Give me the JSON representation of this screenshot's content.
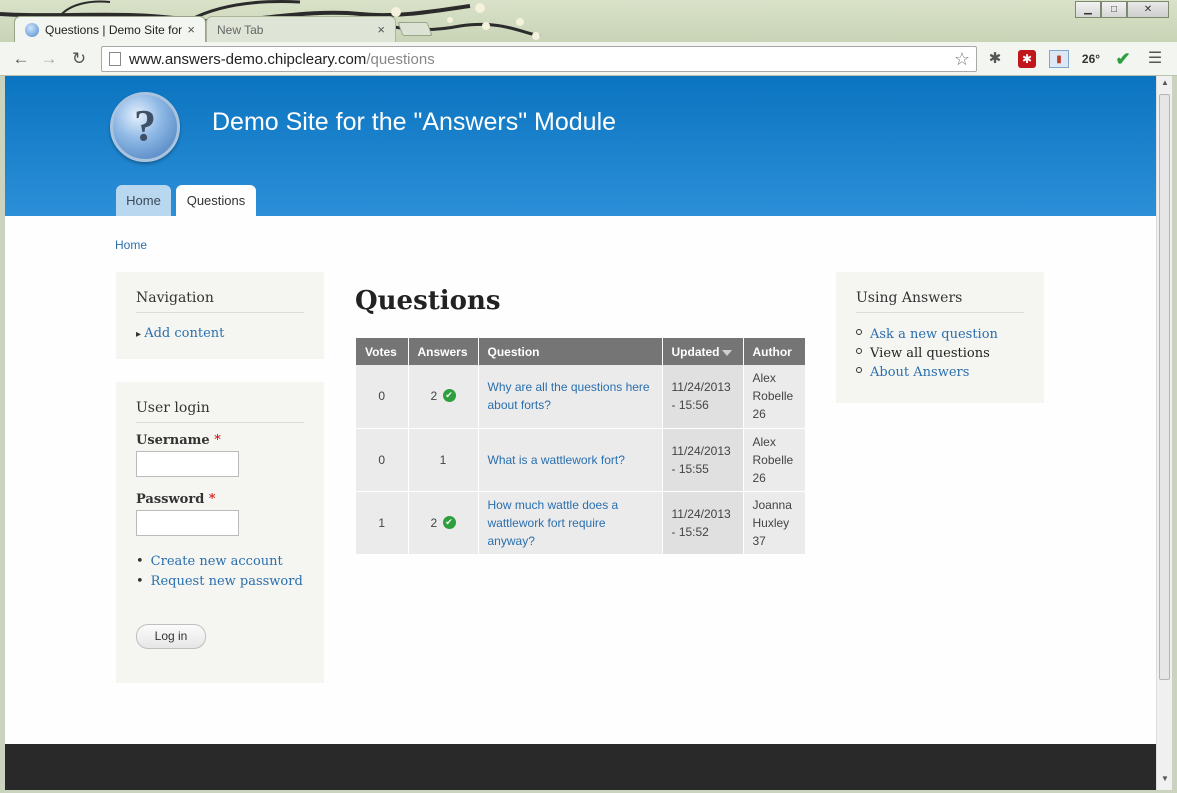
{
  "browser": {
    "tabs": [
      {
        "title": "Questions | Demo Site for",
        "close": "×"
      },
      {
        "title": "New Tab",
        "close": "×"
      }
    ],
    "url_domain": "www.answers-demo.chipcleary.com",
    "url_path": "/questions",
    "weather_badge": "26°",
    "window_controls": {
      "minimize": "▁",
      "maximize": "□",
      "close": "✕"
    },
    "icons": [
      "back-icon",
      "forward-icon",
      "reload-icon",
      "page-icon",
      "bookmark-star-icon",
      "extension-bug-icon",
      "lastpass-icon",
      "mail-icon",
      "check-icon",
      "menu-icon"
    ]
  },
  "site": {
    "name": "Demo Site for the \"Answers\" Module",
    "logo_glyph": "?",
    "main_menu": [
      {
        "label": "Home"
      },
      {
        "label": "Questions"
      }
    ]
  },
  "breadcrumb": "Home",
  "sidebar_first": {
    "navigation": {
      "title": "Navigation",
      "links": [
        {
          "label": "Add content"
        }
      ]
    },
    "user_login": {
      "title": "User login",
      "username_label": "Username",
      "password_label": "Password",
      "required_marker": "*",
      "links": [
        {
          "label": "Create new account"
        },
        {
          "label": "Request new password"
        }
      ],
      "submit_label": "Log in"
    }
  },
  "content": {
    "title": "Questions",
    "table": {
      "headers": [
        "Votes",
        "Answers",
        "Question",
        "Updated",
        "Author"
      ],
      "sorted_by": "Updated",
      "rows": [
        {
          "votes": "0",
          "answers": "2",
          "accepted": true,
          "question": "Why are all the questions here about forts?",
          "updated": "11/24/2013 - 15:56",
          "author": "Alex Robelle 26"
        },
        {
          "votes": "0",
          "answers": "1",
          "accepted": false,
          "question": "What is a wattlework fort?",
          "updated": "11/24/2013 - 15:55",
          "author": "Alex Robelle 26"
        },
        {
          "votes": "1",
          "answers": "2",
          "accepted": true,
          "question": "How much wattle does a wattlework fort require anyway?",
          "updated": "11/24/2013 - 15:52",
          "author": "Joanna Huxley 37"
        }
      ]
    }
  },
  "sidebar_second": {
    "using_answers": {
      "title": "Using Answers",
      "links": [
        {
          "label": "Ask a new question",
          "current": false
        },
        {
          "label": "View all questions",
          "current": true
        },
        {
          "label": "About Answers",
          "current": false
        }
      ]
    }
  },
  "colors": {
    "header_top": "#0b74c0",
    "header_bottom": "#2c8fd8",
    "link": "#2a6fae",
    "table_header": "#757575",
    "footer": "#292929",
    "accepted": "#2d9f3d"
  }
}
